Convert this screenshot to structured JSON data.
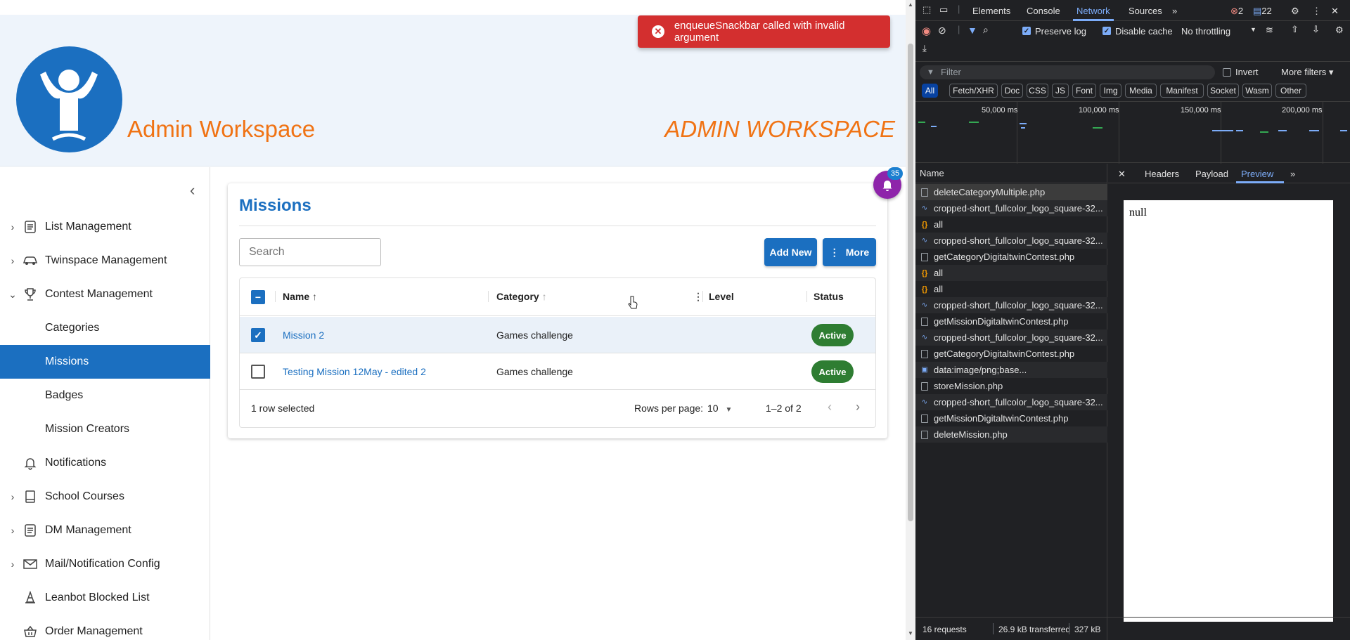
{
  "app": {
    "brand_left": "Admin Workspace",
    "brand_right": "ADMIN WORKSPACE",
    "toast": "enqueueSnackbar called with invalid argument",
    "notification_count": "35"
  },
  "sidebar": {
    "items": [
      {
        "label": "List Management",
        "chevron": "›",
        "icon": "list-icon"
      },
      {
        "label": "Twinspace Management",
        "chevron": "›",
        "icon": "car-icon"
      },
      {
        "label": "Contest Management",
        "chevron": "⌄",
        "icon": "trophy-icon"
      },
      {
        "label": "Categories"
      },
      {
        "label": "Missions",
        "active": true
      },
      {
        "label": "Badges"
      },
      {
        "label": "Mission Creators"
      },
      {
        "label": "Notifications",
        "icon": "bell-icon"
      },
      {
        "label": "School Courses",
        "chevron": "›",
        "icon": "book-icon"
      },
      {
        "label": "DM Management",
        "chevron": "›",
        "icon": "list-icon"
      },
      {
        "label": "Mail/Notification Config",
        "chevron": "›",
        "icon": "mail-icon"
      },
      {
        "label": "Leanbot Blocked List",
        "icon": "cone-icon"
      },
      {
        "label": "Order Management",
        "icon": "basket-icon"
      }
    ]
  },
  "missions": {
    "title": "Missions",
    "search_placeholder": "Search",
    "add_label": "Add New",
    "more_label": "More",
    "columns": [
      "Name",
      "Category",
      "Level",
      "Status"
    ],
    "rows": [
      {
        "name": "Mission 2",
        "category": "Games challenge",
        "level": "",
        "status": "Active",
        "selected": true
      },
      {
        "name": "Testing Mission 12May - edited 2",
        "category": "Games challenge",
        "level": "",
        "status": "Active",
        "selected": false
      }
    ],
    "selection_text": "1 row selected",
    "rows_per_page_label": "Rows per page:",
    "rows_per_page": "10",
    "range": "1–2 of 2"
  },
  "devtools": {
    "tabs": [
      "Elements",
      "Console",
      "Network",
      "Sources"
    ],
    "active_tab": "Network",
    "error_count": "2",
    "message_count": "22",
    "preserve_log": "Preserve log",
    "disable_cache": "Disable cache",
    "throttling": "No throttling",
    "filter_placeholder": "Filter",
    "invert": "Invert",
    "more_filters": "More filters",
    "types": [
      "All",
      "Fetch/XHR",
      "Doc",
      "CSS",
      "JS",
      "Font",
      "Img",
      "Media",
      "Manifest",
      "Socket",
      "Wasm",
      "Other"
    ],
    "timeline_ticks": [
      "50,000 ms",
      "100,000 ms",
      "150,000 ms",
      "200,000 ms"
    ],
    "name_header": "Name",
    "requests": [
      {
        "name": "deleteCategoryMultiple.php",
        "kind": "doc"
      },
      {
        "name": "cropped-short_fullcolor_logo_square-32...",
        "kind": "img"
      },
      {
        "name": "all",
        "kind": "xhr"
      },
      {
        "name": "cropped-short_fullcolor_logo_square-32...",
        "kind": "img"
      },
      {
        "name": "getCategoryDigitaltwinContest.php",
        "kind": "doc"
      },
      {
        "name": "all",
        "kind": "xhr"
      },
      {
        "name": "all",
        "kind": "xhr"
      },
      {
        "name": "cropped-short_fullcolor_logo_square-32...",
        "kind": "img"
      },
      {
        "name": "getMissionDigitaltwinContest.php",
        "kind": "doc"
      },
      {
        "name": "cropped-short_fullcolor_logo_square-32...",
        "kind": "img"
      },
      {
        "name": "getCategoryDigitaltwinContest.php",
        "kind": "doc"
      },
      {
        "name": "data:image/png;base...",
        "kind": "png"
      },
      {
        "name": "storeMission.php",
        "kind": "doc"
      },
      {
        "name": "cropped-short_fullcolor_logo_square-32...",
        "kind": "img"
      },
      {
        "name": "getMissionDigitaltwinContest.php",
        "kind": "doc"
      },
      {
        "name": "deleteMission.php",
        "kind": "doc"
      }
    ],
    "detail_tabs": [
      "Headers",
      "Payload",
      "Preview"
    ],
    "active_detail": "Preview",
    "preview_text": "null",
    "footer": {
      "requests": "16 requests",
      "transferred": "26.9 kB transferred",
      "resources": "327 kB"
    }
  },
  "colors": {
    "primary": "#1b6fc0",
    "brand": "#f07314",
    "error": "#d32f2f",
    "active": "#2e7d32",
    "bell": "#8e24aa"
  }
}
